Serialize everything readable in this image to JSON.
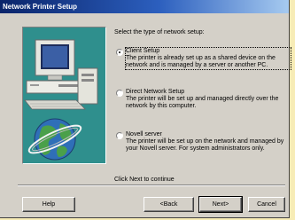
{
  "window": {
    "title": "Network Printer Setup"
  },
  "art": {
    "icon": "computer-and-globe-illustration"
  },
  "content": {
    "intro": "Select the type of network setup:",
    "options": [
      {
        "title": "Client Setup",
        "description": "The printer is already set up as a shared device on the network and is managed by a server or another PC.",
        "selected": true
      },
      {
        "title": "Direct Network Setup",
        "description": "The printer will be set up and managed directly over the network by this computer.",
        "selected": false
      },
      {
        "title": "Novell server",
        "description": "The printer will be set up on the network and managed by your Novell server. For system administrators only.",
        "selected": false
      }
    ],
    "next_hint": "Click Next to continue"
  },
  "buttons": {
    "help": "Help",
    "back": "<Back",
    "next": "Next>",
    "cancel": "Cancel"
  },
  "colors": {
    "titlebar_start": "#0a246a",
    "titlebar_end": "#a6caf0",
    "dialog_face": "#d4d0c8",
    "art_background": "#2f8f8d",
    "page_background": "#f7ecb6"
  }
}
